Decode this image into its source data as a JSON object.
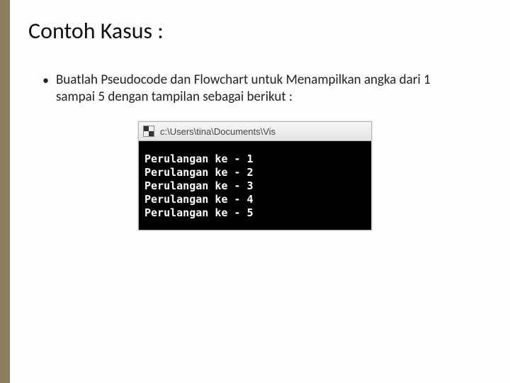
{
  "slide": {
    "title": "Contoh Kasus :",
    "bullet": "Buatlah Pseudocode dan Flowchart untuk Menampilkan angka dari 1 sampai 5 dengan tampilan sebagai berikut :"
  },
  "window": {
    "path": "c:\\Users\\tina\\Documents\\Vis"
  },
  "console": {
    "lines": [
      "Perulangan ke - 1",
      "Perulangan ke - 2",
      "Perulangan ke - 3",
      "Perulangan ke - 4",
      "Perulangan ke - 5"
    ]
  }
}
